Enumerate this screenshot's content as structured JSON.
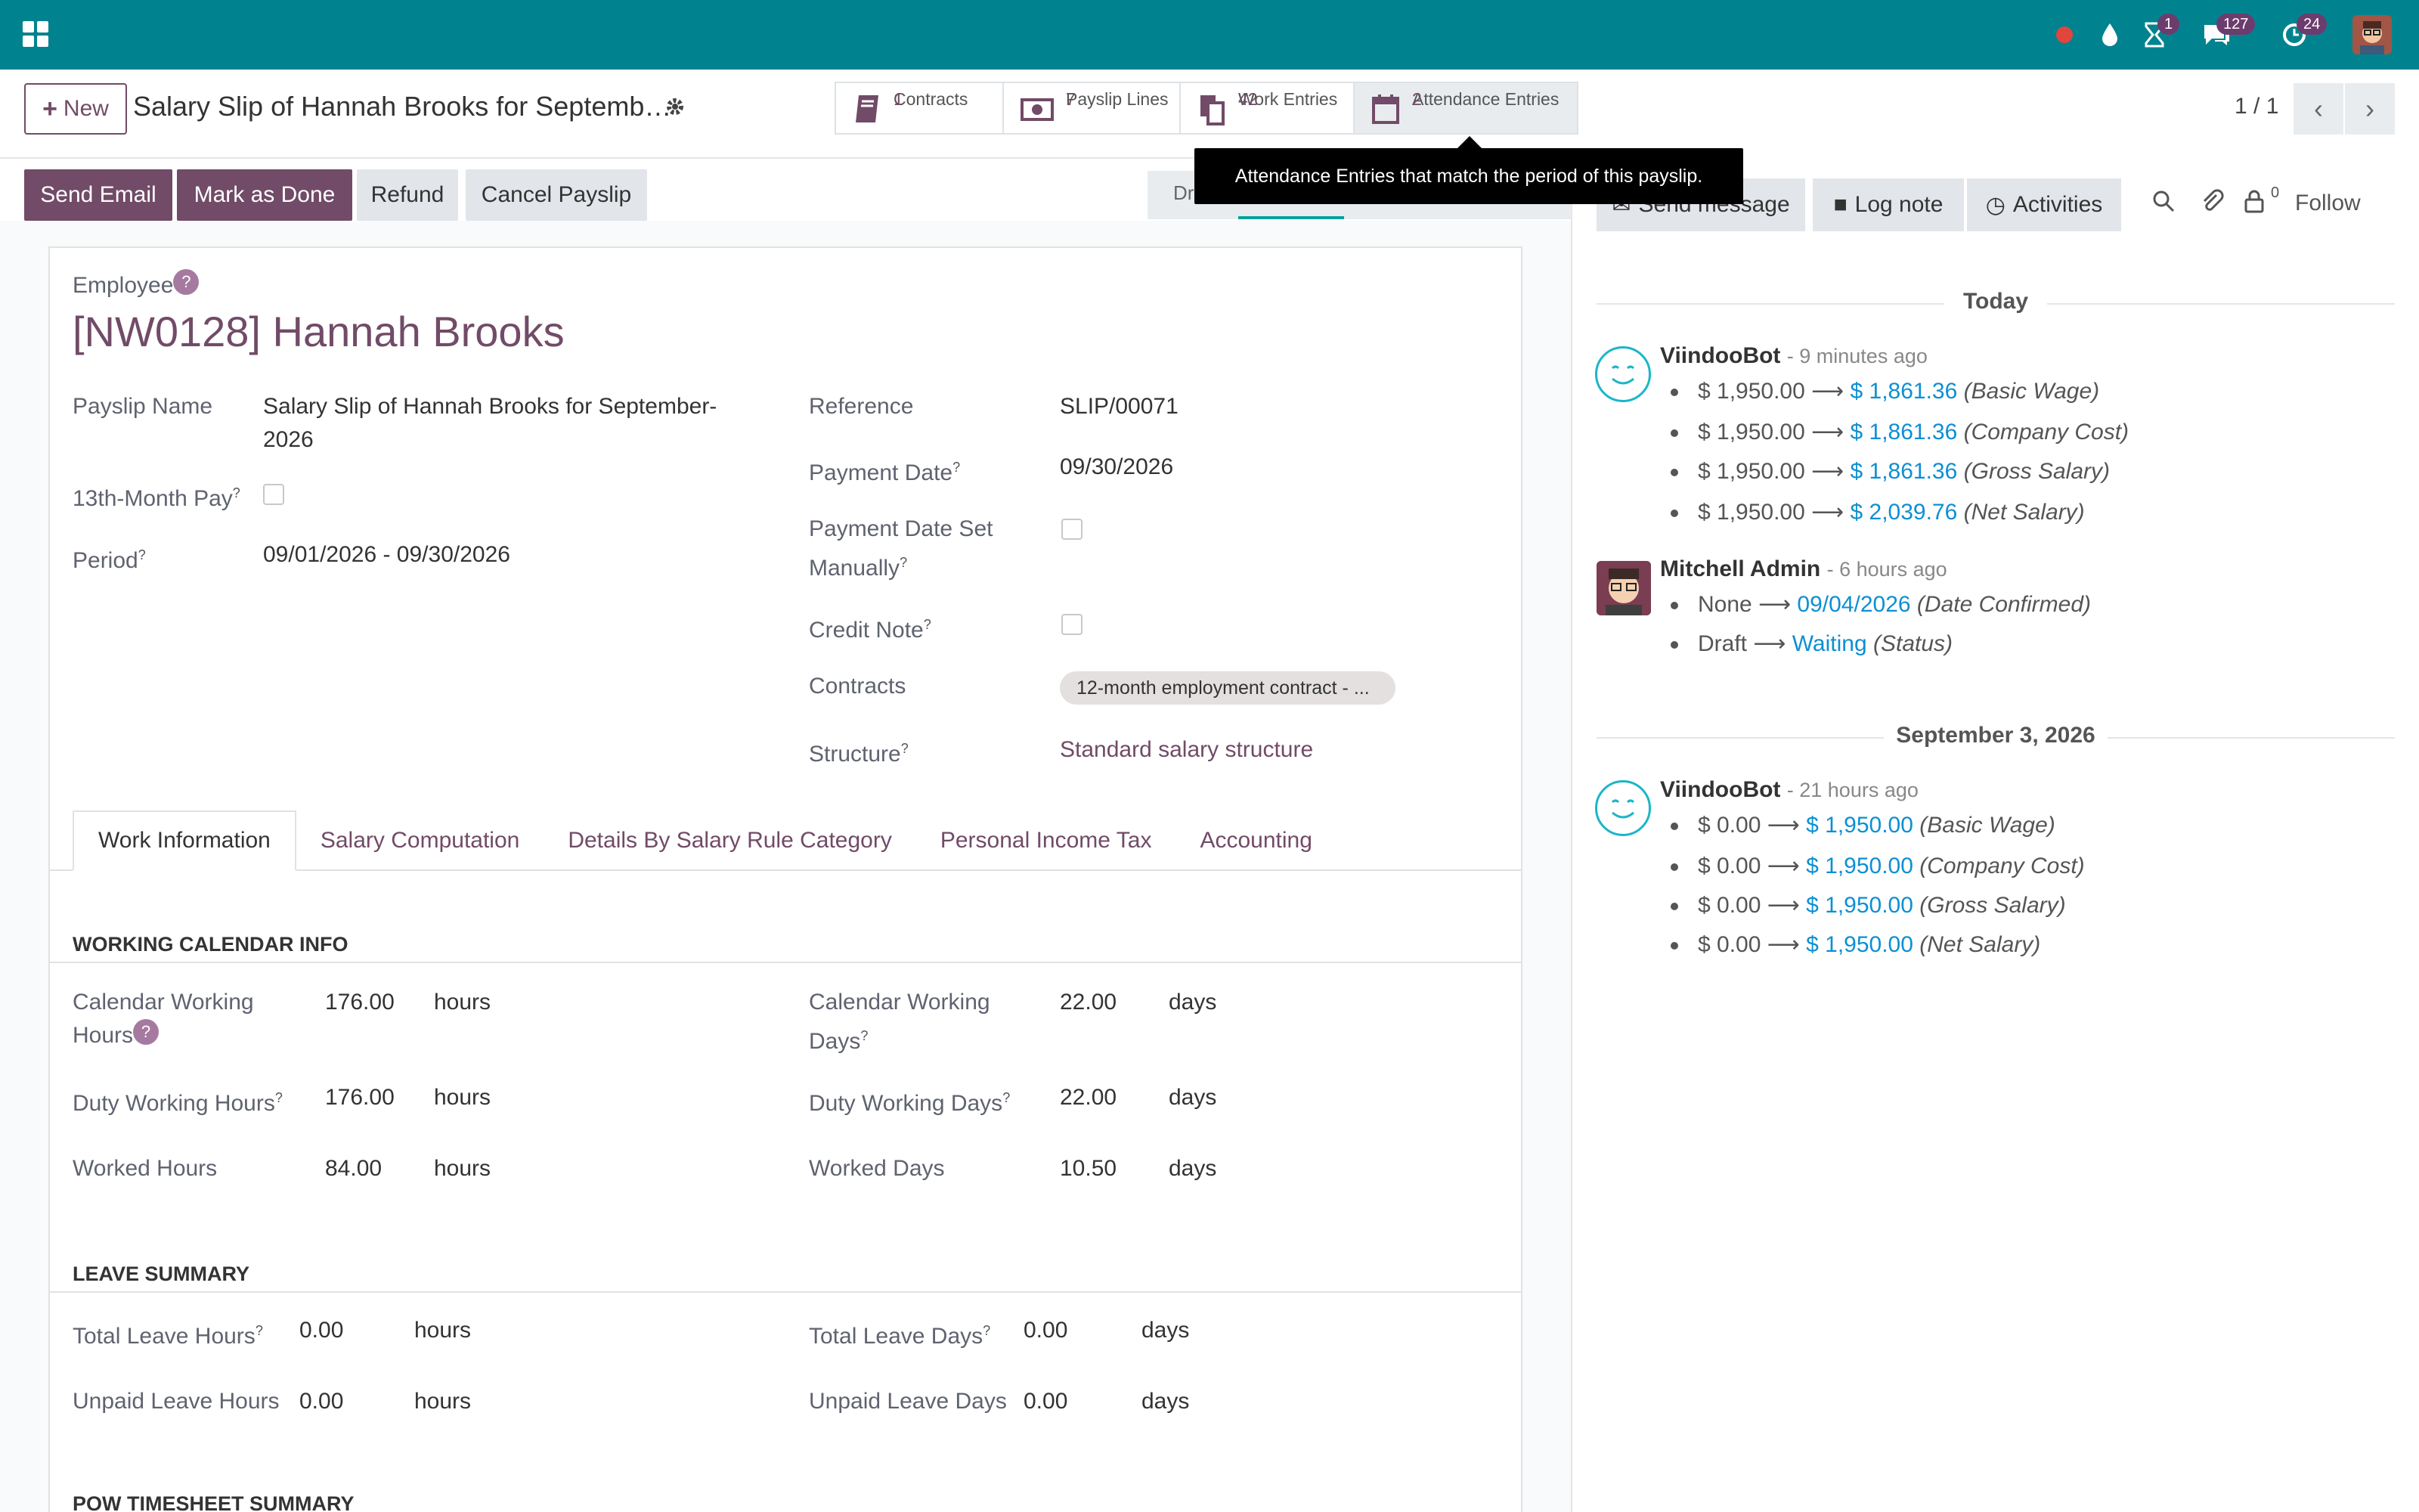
{
  "topbar": {
    "badges": {
      "activities": "1",
      "messages": "127",
      "clock": "24"
    }
  },
  "control": {
    "new_label": "New",
    "title": "Salary Slip of Hannah Brooks for Septemb…",
    "pager": "1 / 1",
    "smart_buttons": [
      {
        "label": "Contracts",
        "value": "1",
        "icon": "book-icon"
      },
      {
        "label": "Payslip Lines",
        "value": "7",
        "icon": "money-icon"
      },
      {
        "label": "Work Entries",
        "value": "42",
        "icon": "files-icon"
      },
      {
        "label": "Attendance Entries",
        "value": "2",
        "icon": "calendar-icon"
      }
    ]
  },
  "tooltip": "Attendance Entries that match the period of this payslip.",
  "actions": {
    "send_email": "Send Email",
    "mark_done": "Mark as Done",
    "refund": "Refund",
    "cancel": "Cancel Payslip",
    "status_partial": "Dr"
  },
  "form": {
    "employee_label": "Employee",
    "employee_name": "[NW0128] Hannah Brooks",
    "payslip_name_label": "Payslip Name",
    "payslip_name_line1": "Salary Slip of Hannah Brooks for September-",
    "payslip_name_line2": "2026",
    "thirteenth_label": "13th-Month Pay",
    "period_label": "Period",
    "period_value": "09/01/2026 - 09/30/2026",
    "reference_label": "Reference",
    "reference_value": "SLIP/00071",
    "payment_date_label": "Payment Date",
    "payment_date_value": "09/30/2026",
    "payment_manual_label_1": "Payment Date Set",
    "payment_manual_label_2": "Manually",
    "credit_note_label": "Credit Note",
    "contracts_label": "Contracts",
    "contracts_tag": "12-month employment contract - ...",
    "structure_label": "Structure",
    "structure_value": "Standard salary structure"
  },
  "tabs": [
    "Work Information",
    "Salary Computation",
    "Details By Salary Rule Category",
    "Personal Income Tax",
    "Accounting"
  ],
  "work_calendar": {
    "title": "WORKING CALENDAR INFO",
    "cal_hours_label_1": "Calendar Working",
    "cal_hours_label_2": "Hours",
    "cal_hours": "176.00",
    "cal_days_label_1": "Calendar Working",
    "cal_days_label_2": "Days",
    "cal_days": "22.00",
    "duty_hours_label": "Duty Working Hours",
    "duty_hours": "176.00",
    "duty_days_label": "Duty Working Days",
    "duty_days": "22.00",
    "worked_hours_label": "Worked Hours",
    "worked_hours": "84.00",
    "worked_days_label": "Worked Days",
    "worked_days": "10.50",
    "unit_hours": "hours",
    "unit_days": "days"
  },
  "leave": {
    "title": "LEAVE SUMMARY",
    "total_hours_label": "Total Leave Hours",
    "total_hours": "0.00",
    "total_days_label": "Total Leave Days",
    "total_days": "0.00",
    "unpaid_hours_label": "Unpaid Leave Hours",
    "unpaid_hours": "0.00",
    "unpaid_days_label": "Unpaid Leave Days",
    "unpaid_days": "0.00"
  },
  "next_section": "POW TIMESHEET SUMMARY",
  "chatter": {
    "send_message": "Send message",
    "log_note": "Log note",
    "activities": "Activities",
    "follow": "Follow",
    "follower_count": "0",
    "today": "Today",
    "sep_date": "September 3, 2026",
    "msg1": {
      "author": "ViindooBot",
      "ago": "- 9 minutes ago",
      "lines": [
        {
          "old": "$ 1,950.00",
          "new": "$ 1,861.36",
          "field": "(Basic Wage)"
        },
        {
          "old": "$ 1,950.00",
          "new": "$ 1,861.36",
          "field": "(Company Cost)"
        },
        {
          "old": "$ 1,950.00",
          "new": "$ 1,861.36",
          "field": "(Gross Salary)"
        },
        {
          "old": "$ 1,950.00",
          "new": "$ 2,039.76",
          "field": "(Net Salary)"
        }
      ]
    },
    "msg2": {
      "author": "Mitchell Admin",
      "ago": "- 6 hours ago",
      "lines": [
        {
          "old": "None",
          "new": "09/04/2026",
          "field": "(Date Confirmed)"
        },
        {
          "old": "Draft",
          "new": "Waiting",
          "field": "(Status)"
        }
      ]
    },
    "msg3": {
      "author": "ViindooBot",
      "ago": "- 21 hours ago",
      "lines": [
        {
          "old": "$ 0.00",
          "new": "$ 1,950.00",
          "field": "(Basic Wage)"
        },
        {
          "old": "$ 0.00",
          "new": "$ 1,950.00",
          "field": "(Company Cost)"
        },
        {
          "old": "$ 0.00",
          "new": "$ 1,950.00",
          "field": "(Gross Salary)"
        },
        {
          "old": "$ 0.00",
          "new": "$ 1,950.00",
          "field": "(Net Salary)"
        }
      ]
    }
  }
}
